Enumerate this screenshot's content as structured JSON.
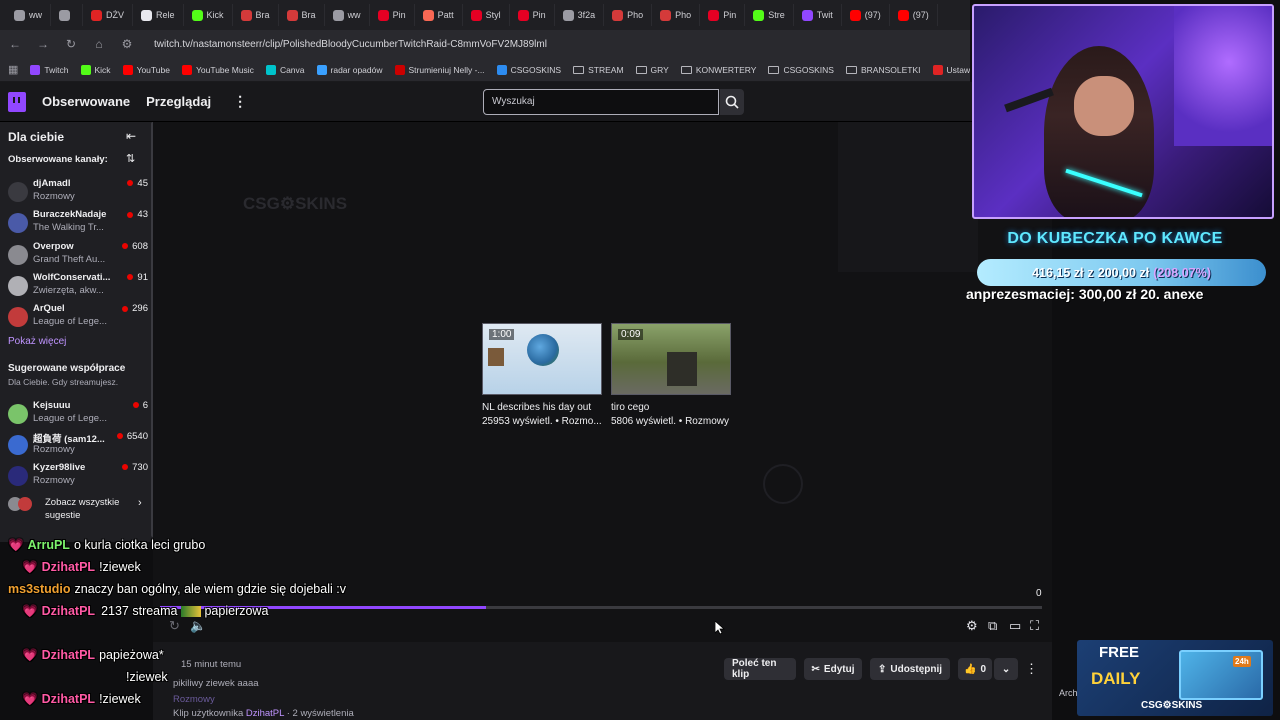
{
  "browser": {
    "tabs": [
      {
        "label": "ww",
        "color": "#9b9ba3"
      },
      {
        "label": "",
        "color": "#9b9ba3"
      },
      {
        "label": "DŻV",
        "color": "#e02424"
      },
      {
        "label": "Rele",
        "color": "#e8e8ee"
      },
      {
        "label": "Kick",
        "color": "#53fc18"
      },
      {
        "label": "Bra",
        "color": "#d43a3a"
      },
      {
        "label": "Bra",
        "color": "#d43a3a"
      },
      {
        "label": "ww",
        "color": "#9b9ba3"
      },
      {
        "label": "Pin",
        "color": "#e60023"
      },
      {
        "label": "Patt",
        "color": "#f96854"
      },
      {
        "label": "Styl",
        "color": "#e60023"
      },
      {
        "label": "Pin",
        "color": "#e60023"
      },
      {
        "label": "3f2a",
        "color": "#9b9ba3"
      },
      {
        "label": "Pho",
        "color": "#d43a3a"
      },
      {
        "label": "Pho",
        "color": "#d43a3a"
      },
      {
        "label": "Pin",
        "color": "#e60023"
      },
      {
        "label": "Stre",
        "color": "#53fc18"
      },
      {
        "label": "Twit",
        "color": "#9147ff"
      },
      {
        "label": "(97)",
        "color": "#ff0000"
      },
      {
        "label": "(97)",
        "color": "#ff0000"
      }
    ],
    "url": "twitch.tv/nastamonsteerr/clip/PolishedBloodyCucumberTwitchRaid-C8mmVoFV2MJ89lml",
    "bookmarks": [
      {
        "label": "Twitch",
        "color": "#9147ff",
        "folder": false
      },
      {
        "label": "Kick",
        "color": "#53fc18",
        "folder": false
      },
      {
        "label": "YouTube",
        "color": "#ff0000",
        "folder": false
      },
      {
        "label": "YouTube Music",
        "color": "#ff0000",
        "folder": false
      },
      {
        "label": "Canva",
        "color": "#00c4cc",
        "folder": false
      },
      {
        "label": "radar opadów",
        "color": "#3aa0ff",
        "folder": false
      },
      {
        "label": "Strumieniuj Nelly -...",
        "color": "#cc0000",
        "folder": false
      },
      {
        "label": "CSGOSKINS",
        "color": "#2d8cf0",
        "folder": false
      },
      {
        "label": "STREAM",
        "color": "",
        "folder": true
      },
      {
        "label": "GRY",
        "color": "",
        "folder": true
      },
      {
        "label": "KONWERTERY",
        "color": "",
        "folder": true
      },
      {
        "label": "CSGOSKINS",
        "color": "",
        "folder": true
      },
      {
        "label": "BRANSOLETKI",
        "color": "",
        "folder": true
      },
      {
        "label": "Ustawienia strumien...",
        "color": "#e02424",
        "folder": false
      }
    ]
  },
  "topnav": {
    "following": "Obserwowane",
    "browse": "Przeglądaj",
    "search_placeholder": "Wyszukaj"
  },
  "sidebar": {
    "title": "Dla ciebie",
    "followed_header": "Obserwowane kanały:",
    "channels": [
      {
        "name": "djAmadl",
        "game": "Rozmowy",
        "viewers": "45",
        "avatar": "#3a3a40"
      },
      {
        "name": "BuraczekNadaje",
        "game": "The Walking Tr...",
        "viewers": "43",
        "avatar": "#4a5aa8"
      },
      {
        "name": "Overpow",
        "game": "Grand Theft Au...",
        "viewers": "608",
        "avatar": "#8a8a90"
      },
      {
        "name": "WolfConservati...",
        "game": "Zwierzęta, akw...",
        "viewers": "91",
        "avatar": "#b0b0b5"
      },
      {
        "name": "ArQuel",
        "game": "League of Lege...",
        "viewers": "296",
        "avatar": "#c23b3b"
      }
    ],
    "show_more": "Pokaż więcej",
    "suggested_title": "Sugerowane współprace",
    "suggested_sub": "Dla Ciebie. Gdy streamujesz.",
    "suggested": [
      {
        "name": "Kejsuuu",
        "game": "League of Lege...",
        "viewers": "6",
        "avatar": "#7ac46a"
      },
      {
        "name": "超負荷 (sam12...",
        "game": "Rozmowy",
        "viewers": "6540",
        "avatar": "#3a6ad0"
      },
      {
        "name": "Kyzer98live",
        "game": "Rozmowy",
        "viewers": "730",
        "avatar": "#2a2a7a"
      }
    ],
    "see_all_line1": "Zobacz wszystkie",
    "see_all_line2": "sugestie"
  },
  "clips": [
    {
      "duration": "1:00",
      "title": "NL describes his day out",
      "meta": "25953 wyświetl. • Rozmo..."
    },
    {
      "duration": "0:09",
      "title": "tiro cego",
      "meta": "5806 wyświetl. • Rozmowy"
    }
  ],
  "player": {
    "progress": 0.37,
    "counter": "0"
  },
  "bottom": {
    "time_ago": "15 minut temu",
    "clip_title": "pikiliwy ziewek aaaa",
    "category": "Rozmowy",
    "clip_by_prefix": "Klip użytkownika",
    "clip_by_user": "DzihatPL",
    "clip_views": "· 2 wyświetlenia",
    "recommend": "Poleć ten klip",
    "edit": "Edytuj",
    "share": "Udostępnij",
    "likes": "0"
  },
  "chat": [
    {
      "user": "ArruPL",
      "text": "o kurla ciotka leci grubo",
      "color": "#7cf26c",
      "heart": true
    },
    {
      "user": "DzihatPL",
      "text": "!ziewek",
      "color": "#ff5aa5",
      "heart": true
    },
    {
      "user": "ms3studio",
      "text": "znaczy ban ogólny, ale wiem gdzie się dojebali :v",
      "color": "#f0a030",
      "heart": false
    },
    {
      "user": "DzihatPL",
      "text": "2137 streama",
      "text2": "papierzowa",
      "color": "#ff5aa5",
      "heart": true
    },
    {
      "user": "DzihatPL",
      "text": "papieżowa*",
      "color": "#ff5aa5",
      "heart": true
    },
    {
      "user": "",
      "text": "!ziewek",
      "color": "#ff5aa5",
      "heart": false
    },
    {
      "user": "DzihatPL",
      "text": "!ziewek",
      "color": "#ff5aa5",
      "heart": true
    }
  ],
  "overlay": {
    "goal_title": "DO KUBECZKA PO KAWCE",
    "goal_current": "416,15 zł",
    "goal_sep": "z",
    "goal_target": "200,00 zł",
    "goal_percent": "(208.07%)",
    "ticker": "anprezesmaciej: 300,00 zł    20. anexe",
    "ad_line1": "FREE",
    "ad_line2": "DAILY",
    "ad_brand": "CSG⚙SKINS",
    "ad_badge": "24h"
  },
  "misc": {
    "ghost_logo": "CSG⚙SKINS",
    "arch": "Arch"
  }
}
